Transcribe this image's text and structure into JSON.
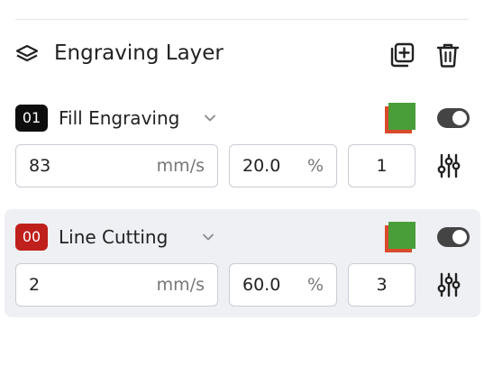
{
  "header": {
    "title": "Engraving Layer"
  },
  "layers": [
    {
      "badge": "01",
      "badge_color": "#0d0d0d",
      "name": "Fill Engraving",
      "speed": "83",
      "speed_unit": "mm/s",
      "power": "20.0",
      "power_unit": "%",
      "passes": "1",
      "enabled": true,
      "selected": false
    },
    {
      "badge": "00",
      "badge_color": "#c0201c",
      "name": "Line Cutting",
      "speed": "2",
      "speed_unit": "mm/s",
      "power": "60.0",
      "power_unit": "%",
      "passes": "3",
      "enabled": true,
      "selected": true
    }
  ],
  "colors": {
    "swatch_front": "#4a9e3a",
    "swatch_back": "#d94b2b",
    "toggle_on": "#444444",
    "selected_bg": "#eef0f4"
  }
}
